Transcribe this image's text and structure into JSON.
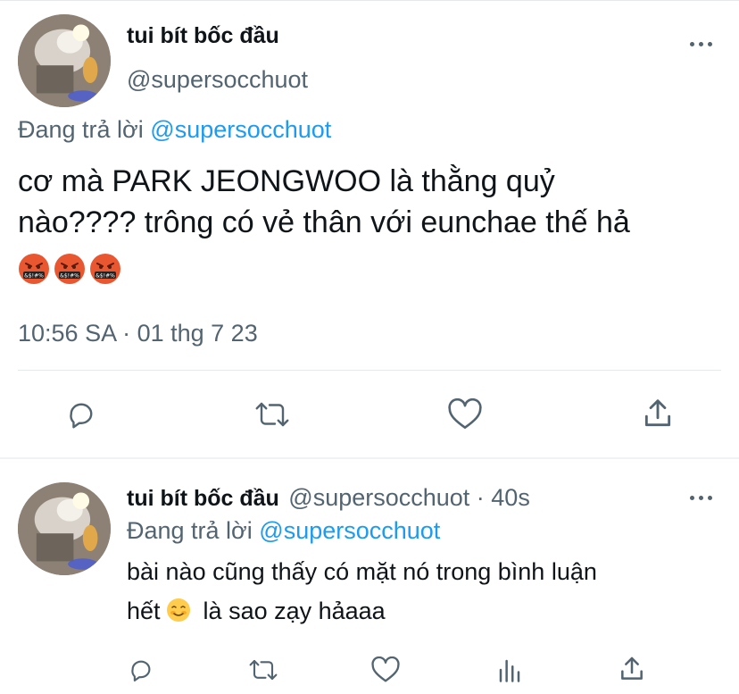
{
  "main_tweet": {
    "display_name": "tui bít bốc đầu",
    "handle": "@supersocchuot",
    "replying_prefix": "Đang trả lời",
    "replying_to": "@supersocchuot",
    "text_line1": "cơ mà PARK JEONGWOO là thằng quỷ",
    "text_line2": "nào???? trông có vẻ thân với eunchae thế hả",
    "emojis": [
      "face-with-symbols-on-mouth",
      "face-with-symbols-on-mouth",
      "face-with-symbols-on-mouth"
    ],
    "timestamp": "10:56 SA · 01 thg 7 23",
    "actions": [
      "reply-icon",
      "retweet-icon",
      "like-icon",
      "share-icon"
    ]
  },
  "reply_tweet": {
    "display_name": "tui bít bốc đầu",
    "handle_time": "@supersocchuot · 40s",
    "replying_prefix": "Đang trả lời",
    "replying_to": "@supersocchuot",
    "text_line1": "bài nào cũng thấy có mặt nó trong bình luận",
    "text_line2_a": "hết",
    "text_line2_b": "là sao zạy hảaaa",
    "emoji": "smiling-face",
    "actions": [
      "reply-icon",
      "retweet-icon",
      "like-icon",
      "analytics-icon",
      "share-icon"
    ]
  },
  "colors": {
    "link": "#1d9bf0",
    "muted": "#536471",
    "text": "#0f1419",
    "divider": "#e6e9eb"
  }
}
